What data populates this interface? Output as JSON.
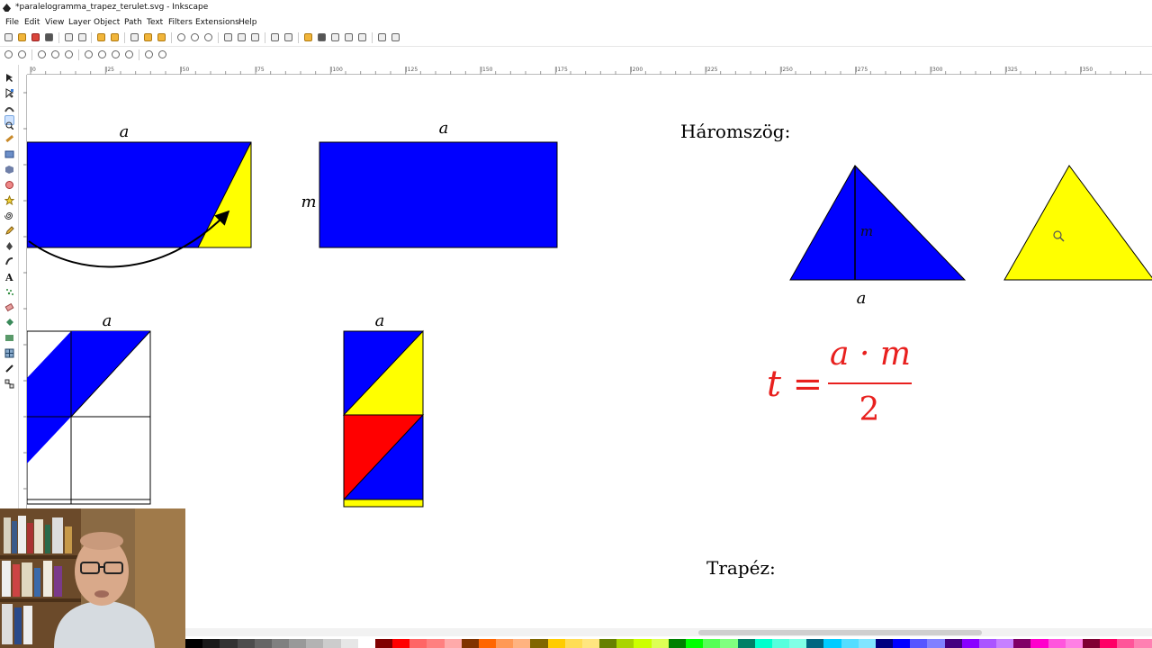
{
  "window": {
    "title": "*paralelogramma_trapez_terulet.svg - Inkscape"
  },
  "menu": {
    "items": [
      "File",
      "Edit",
      "View",
      "Layer",
      "Object",
      "Path",
      "Text",
      "Filters",
      "Extensions",
      "Help"
    ]
  },
  "ruler": {
    "labels": [
      "|0",
      "|25",
      "|50",
      "|75",
      "|100",
      "|125",
      "|150",
      "|175",
      "|200",
      "|225",
      "|250",
      "|275",
      "|300",
      "|325",
      "|350"
    ]
  },
  "canvas": {
    "label_a1": "a",
    "label_a2": "a",
    "label_m1": "m",
    "label_a3": "a",
    "label_a4": "a",
    "heading_triangle": "Háromszög:",
    "label_m2": "m",
    "label_a5": "a",
    "formula_lhs": "t =",
    "formula_num": "a · m",
    "formula_den": "2",
    "heading_trapezoid": "Trapéz:"
  },
  "colors": {
    "blue": "#0000ff",
    "yellow": "#ffff00",
    "red": "#ff0000",
    "formula": "#e8201e",
    "palette": [
      "#000000",
      "#1a1a1a",
      "#333333",
      "#4d4d4d",
      "#666666",
      "#808080",
      "#999999",
      "#b3b3b3",
      "#cccccc",
      "#e6e6e6",
      "#ffffff",
      "#800000",
      "#ff0000",
      "#ff6666",
      "#ff8080",
      "#ffaaaa",
      "#803300",
      "#ff6600",
      "#ff9955",
      "#ffb380",
      "#806600",
      "#ffcc00",
      "#ffdd55",
      "#ffe680",
      "#668000",
      "#aad400",
      "#ccff00",
      "#ddff55",
      "#008000",
      "#00ff00",
      "#55ff55",
      "#80ff80",
      "#008066",
      "#00ffcc",
      "#55ffdd",
      "#80ffe6",
      "#006680",
      "#00ccff",
      "#55ddff",
      "#80e5ff",
      "#000080",
      "#0000ff",
      "#5555ff",
      "#8080ff",
      "#440080",
      "#8800ff",
      "#aa55ff",
      "#c680ff",
      "#800066",
      "#ff00cc",
      "#ff55dd",
      "#ff80e5",
      "#800033",
      "#ff0066",
      "#ff5599",
      "#ff80b2"
    ]
  }
}
